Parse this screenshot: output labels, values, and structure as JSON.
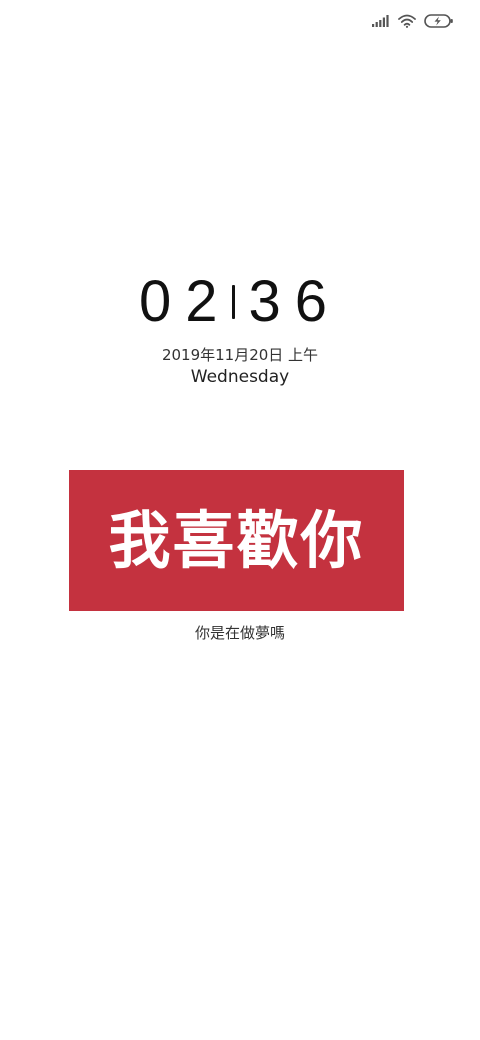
{
  "status_bar": {
    "icons": [
      "signal-icon",
      "wifi-icon",
      "battery-charging-icon"
    ]
  },
  "clock": {
    "hour": "02",
    "minute": "36",
    "date": "2019年11月20日 上午",
    "weekday": "Wednesday"
  },
  "banner": {
    "text": "我喜歡你",
    "background_color": "#c4323f",
    "text_color": "#ffffff"
  },
  "caption": {
    "text": "你是在做夢嗎"
  }
}
